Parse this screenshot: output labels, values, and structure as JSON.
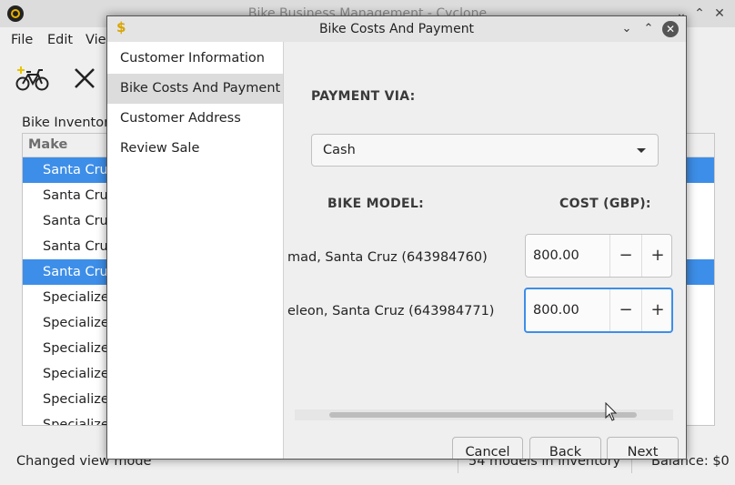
{
  "main_window": {
    "title": "Bike Business Management - Cyclone",
    "menu": [
      "File",
      "Edit",
      "Vie"
    ],
    "inventory_label": "Bike Inventor",
    "table_header_make": "Make",
    "rows": [
      {
        "make": "Santa Cruz",
        "selected": true
      },
      {
        "make": "Santa Cruz",
        "selected": false
      },
      {
        "make": "Santa Cruz",
        "selected": false
      },
      {
        "make": "Santa Cruz",
        "selected": false
      },
      {
        "make": "Santa Cruz",
        "selected": true
      },
      {
        "make": "Specialized",
        "selected": false
      },
      {
        "make": "Specialized",
        "selected": false
      },
      {
        "make": "Specialized",
        "selected": false
      },
      {
        "make": "Specialized",
        "selected": false
      },
      {
        "make": "Specialized",
        "selected": false
      },
      {
        "make": "Specialized",
        "selected": false
      }
    ],
    "status_text": "Changed view mode",
    "status_models": "54 models in inventory",
    "status_balance": "Balance: $0"
  },
  "dialog": {
    "title": "Bike Costs And Payment",
    "icon": "dollar-icon",
    "steps": [
      {
        "label": "Customer Information",
        "active": false
      },
      {
        "label": "Bike Costs And Payment",
        "active": true
      },
      {
        "label": "Customer Address",
        "active": false
      },
      {
        "label": "Review Sale",
        "active": false
      }
    ],
    "payment_label": "PAYMENT VIA:",
    "payment_selected": "Cash",
    "bike_model_header": "BIKE MODEL:",
    "cost_header": "COST (GBP):",
    "lines": [
      {
        "model": "mad, Santa Cruz (643984760)",
        "cost": "800.00",
        "focused": false
      },
      {
        "model": "eleon, Santa Cruz (643984771)",
        "cost": "800.00",
        "focused": true
      }
    ],
    "buttons": {
      "cancel": "Cancel",
      "back": "Back",
      "next": "Next"
    },
    "minus_glyph": "−",
    "plus_glyph": "+"
  },
  "colors": {
    "accent": "#3d8ee8",
    "dollar_icon": "#d9a500"
  }
}
